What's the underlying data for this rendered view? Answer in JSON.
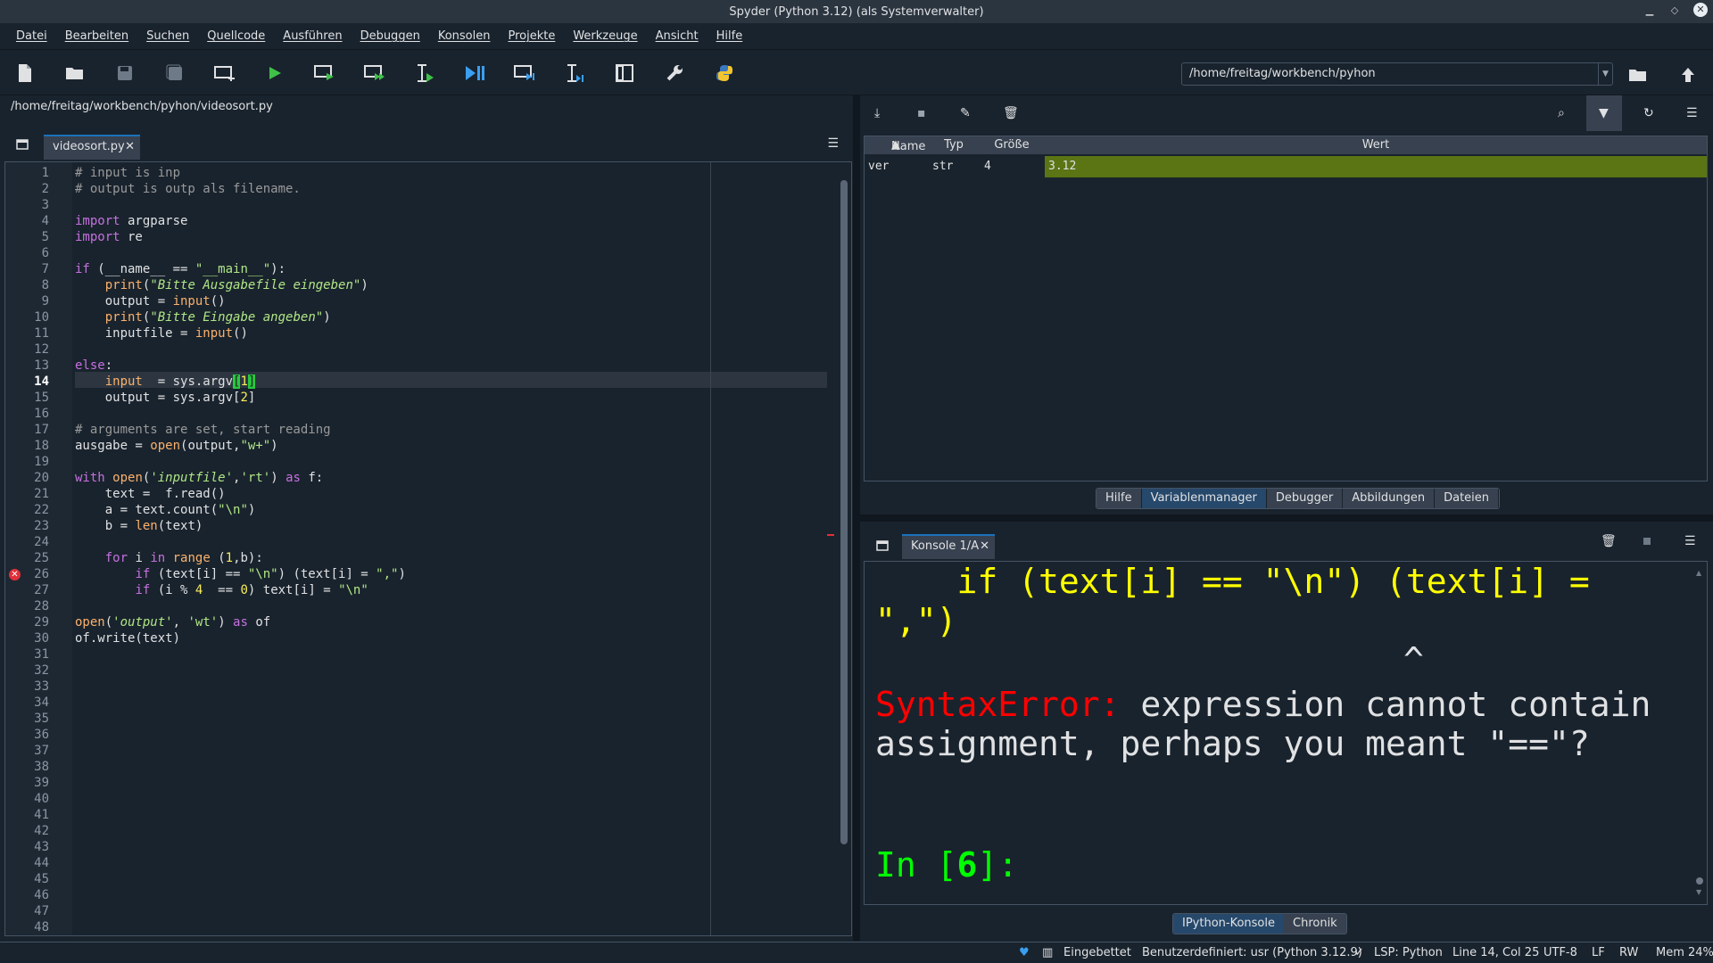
{
  "window": {
    "title": "Spyder (Python 3.12) (als Systemverwalter)"
  },
  "menu": [
    "Datei",
    "Bearbeiten",
    "Suchen",
    "Quellcode",
    "Ausführen",
    "Debuggen",
    "Konsolen",
    "Projekte",
    "Werkzeuge",
    "Ansicht",
    "Hilfe"
  ],
  "toolbar": {
    "working_dir": "/home/freitag/workbench/pyhon"
  },
  "editor": {
    "file_path": "/home/freitag/workbench/pyhon/videosort.py",
    "tab_label": "videosort.py",
    "current_line": 14,
    "error_line": 26,
    "line_count": 48
  },
  "variables": {
    "columns": [
      "Name",
      "Typ",
      "Größe",
      "Wert"
    ],
    "rows": [
      {
        "name": "ver",
        "type": "str",
        "size": "4",
        "value": "3.12"
      }
    ],
    "tabs": [
      "Hilfe",
      "Variablenmanager",
      "Debugger",
      "Abbildungen",
      "Dateien"
    ],
    "active_tab": "Variablenmanager"
  },
  "console": {
    "tab_label": "Konsole 1/A",
    "line1": "    if (text[i] == \"\\n\") (text[i] =",
    "line2": "\",\")",
    "caret": "^",
    "error_name": "SyntaxError:",
    "error_msg1": " expression cannot contain",
    "error_msg2": "assignment, perhaps you meant \"==\"?",
    "prompt_in": "In [",
    "prompt_num": "6",
    "prompt_end": "]:",
    "tabs": [
      "IPython-Konsole",
      "Chronik"
    ],
    "active_tab": "IPython-Konsole"
  },
  "status": {
    "embedded": "Eingebettet",
    "env": "Benutzerdefiniert: usr (Python 3.12.9)",
    "lsp": "LSP: Python",
    "position": "Line 14, Col 25",
    "encoding": "UTF-8",
    "eol": "LF",
    "mode": "RW",
    "mem": "Mem 24%"
  }
}
